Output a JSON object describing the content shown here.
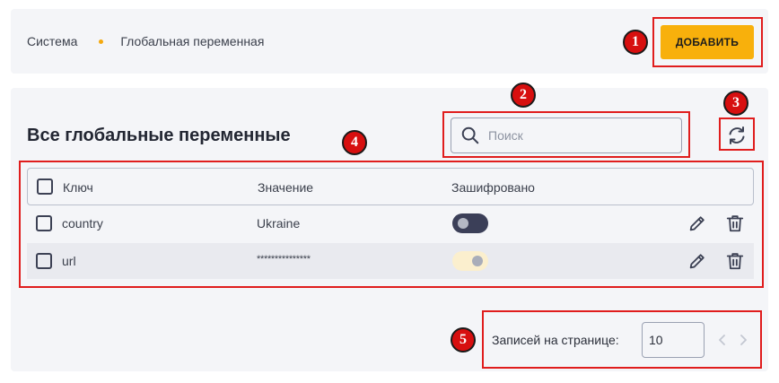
{
  "breadcrumb": {
    "root": "Система",
    "current": "Глобальная переменная"
  },
  "header": {
    "add_label": "ДОБАВИТЬ"
  },
  "main": {
    "title": "Все глобальные переменные",
    "search": {
      "placeholder": "Поиск",
      "value": ""
    }
  },
  "table": {
    "columns": {
      "key": "Ключ",
      "value": "Значение",
      "encrypted": "Зашифровано"
    },
    "rows": [
      {
        "key": "country",
        "value": "Ukraine",
        "encrypted": false
      },
      {
        "key": "url",
        "value": "***************",
        "encrypted": true
      }
    ]
  },
  "pagination": {
    "per_page_label": "Записей на странице:",
    "per_page_value": "10"
  },
  "annotations": {
    "badge1": "1",
    "badge2": "2",
    "badge3": "3",
    "badge4": "4",
    "badge5": "5"
  },
  "colors": {
    "accent": "#f8b00c",
    "annotation_red": "#d70f0f",
    "toggle_dark": "#3b3f58",
    "toggle_light": "#fbefce"
  },
  "icons": {
    "search": "search-icon",
    "refresh": "refresh-icon",
    "edit": "pencil-icon",
    "delete": "trash-icon",
    "prev": "chevron-left-icon",
    "next": "chevron-right-icon"
  }
}
